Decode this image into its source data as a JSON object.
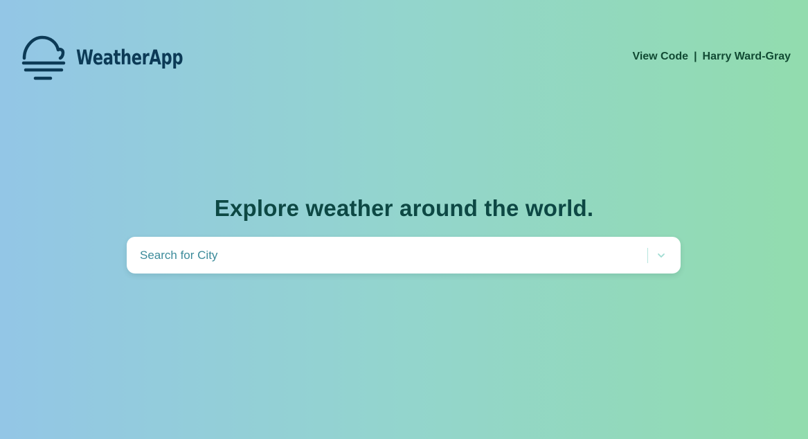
{
  "app": {
    "name": "WeatherApp",
    "logo_icon": "cloud-fog-icon",
    "brand_color": "#0c3a56"
  },
  "nav": {
    "view_code": "View Code",
    "separator": "|",
    "author": "Harry Ward-Gray"
  },
  "main": {
    "headline": "Explore weather around the world."
  },
  "search": {
    "placeholder": "Search for City",
    "value": "",
    "dropdown_icon": "chevron-down-icon"
  },
  "colors": {
    "gradient_start": "#93c6e6",
    "gradient_end": "#92dcae",
    "headline": "#0d4844",
    "nav_text": "#114a33"
  }
}
